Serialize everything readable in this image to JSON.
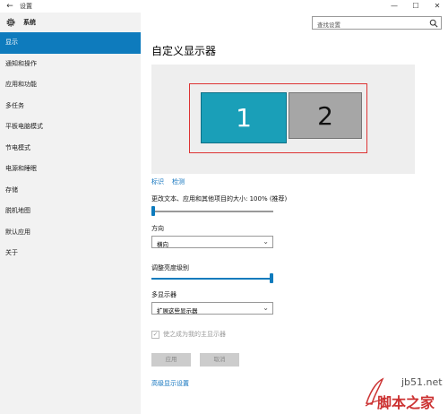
{
  "window": {
    "title": "设置",
    "back_glyph": "←",
    "minimize_glyph": "—",
    "maximize_glyph": "☐",
    "close_glyph": "✕"
  },
  "sidebar": {
    "section_title": "系统",
    "items": [
      {
        "label": "显示",
        "active": true
      },
      {
        "label": "通知和操作"
      },
      {
        "label": "应用和功能"
      },
      {
        "label": "多任务"
      },
      {
        "label": "平板电脑模式"
      },
      {
        "label": "节电模式"
      },
      {
        "label": "电源和睡眠"
      },
      {
        "label": "存储"
      },
      {
        "label": "脱机地图"
      },
      {
        "label": "默认应用"
      },
      {
        "label": "关于"
      }
    ]
  },
  "search": {
    "placeholder": "查找设置"
  },
  "main": {
    "title": "自定义显示器",
    "monitors": [
      "1",
      "2"
    ],
    "link_identify": "标识",
    "link_detect": "检测",
    "scale_label": "更改文本、应用和其他项目的大小: 100% (推荐)",
    "scale_slider_value": 0,
    "orientation_label": "方向",
    "orientation_value": "横向",
    "brightness_label": "调整亮度级别",
    "brightness_slider_value": 1.0,
    "multi_display_label": "多显示器",
    "multi_display_value": "扩展这些显示器",
    "main_display_checkbox": "使之成为我的主显示器",
    "apply_button": "应用",
    "cancel_button": "取消",
    "advanced_link": "高级显示设置"
  },
  "watermark": {
    "domain": "jb51.net",
    "text": "脚本之家"
  },
  "colors": {
    "accent": "#0e7bbd",
    "monitor1": "#1a9fb8",
    "monitor2": "#a6a6a6",
    "selection_border": "#dd3333"
  }
}
